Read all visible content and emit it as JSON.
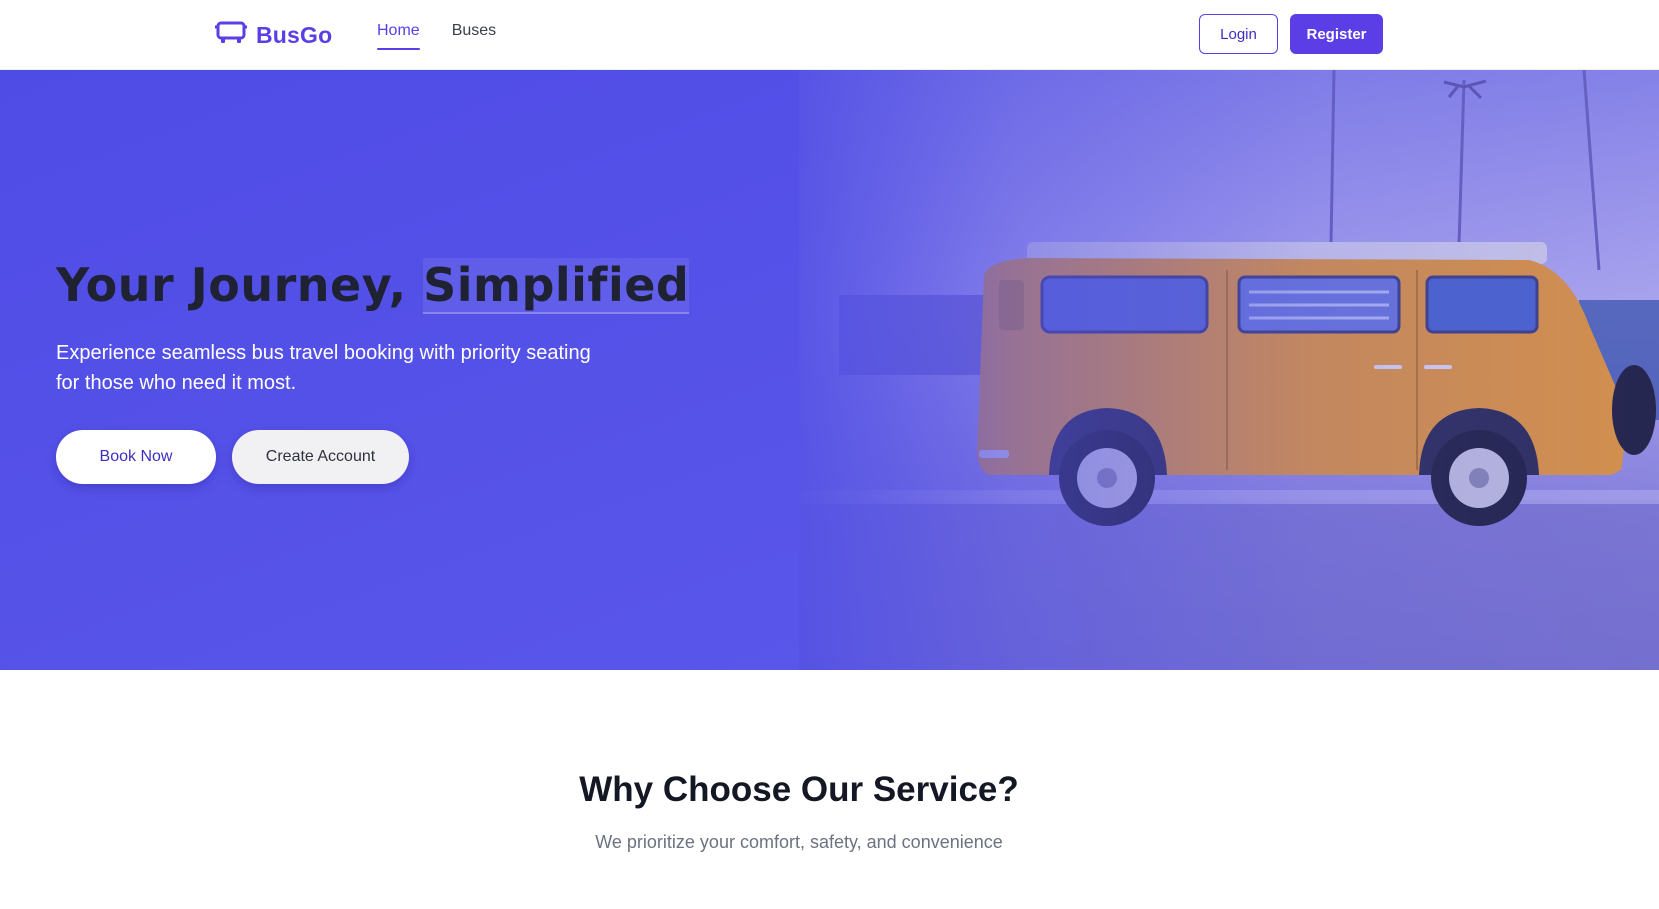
{
  "nav": {
    "brand": "BusGo",
    "brand_icon": "bus-icon",
    "links": [
      {
        "label": "Home",
        "active": true
      },
      {
        "label": "Buses",
        "active": false
      }
    ],
    "login_label": "Login",
    "register_label": "Register"
  },
  "hero": {
    "title_part1": "Your Journey, ",
    "title_part2": "Simplified",
    "subtitle": "Experience seamless bus travel booking with priority seating for those who need it most.",
    "book_label": "Book Now",
    "create_label": "Create Account",
    "image": "orange-van-photo"
  },
  "why": {
    "title": "Why Choose Our Service?",
    "subtitle": "We prioritize your comfort, safety, and convenience"
  },
  "colors": {
    "accent": "#5b3ee6",
    "hero_bg": "#5451e6",
    "heading": "#141824",
    "muted": "#6b7280"
  }
}
